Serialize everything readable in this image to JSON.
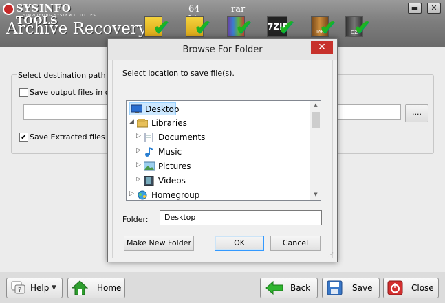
{
  "header": {
    "brand": "SYSINFO TOOLS",
    "brand_tagline": "SIMPLIFYING SYSTEM UTILITIES",
    "title": "Archive Recovery",
    "formats": [
      {
        "icon": "zip-archive-icon",
        "label": ""
      },
      {
        "icon": "zip-archive-64bit-icon",
        "label": "64 bit"
      },
      {
        "icon": "rar-archive-icon",
        "label": "rar"
      },
      {
        "icon": "7zip-archive-icon",
        "label": "7ZIP"
      },
      {
        "icon": "tar-archive-icon",
        "label": "TAR"
      },
      {
        "icon": "gz-archive-icon",
        "label": "GZ"
      }
    ],
    "check_color": "#1fb31f"
  },
  "window_controls": {
    "minimize": "▬",
    "close": "✕"
  },
  "main": {
    "group_title": "Select destination path to sa",
    "option_original": {
      "label": "Save output files in origi",
      "checked": false
    },
    "path_value": "",
    "browse_label": "....",
    "option_extracted": {
      "label": "Save Extracted files in s",
      "checked": true
    }
  },
  "footer": {
    "help_label": "Help",
    "home_label": "Home",
    "back_label": "Back",
    "save_label": "Save",
    "close_label": "Close"
  },
  "dialog": {
    "title": "Browse For Folder",
    "close_glyph": "✕",
    "instruction": "Select location to save file(s).",
    "tree": [
      {
        "label": "Desktop",
        "icon": "desktop-icon",
        "level": 0,
        "expander": "",
        "selected": true
      },
      {
        "label": "Libraries",
        "icon": "libraries-icon",
        "level": 0,
        "expander": "◢",
        "selected": false
      },
      {
        "label": "Documents",
        "icon": "documents-icon",
        "level": 1,
        "expander": "▷",
        "selected": false
      },
      {
        "label": "Music",
        "icon": "music-icon",
        "level": 1,
        "expander": "▷",
        "selected": false
      },
      {
        "label": "Pictures",
        "icon": "pictures-icon",
        "level": 1,
        "expander": "▷",
        "selected": false
      },
      {
        "label": "Videos",
        "icon": "videos-icon",
        "level": 1,
        "expander": "▷",
        "selected": false
      },
      {
        "label": "Homegroup",
        "icon": "homegroup-icon",
        "level": 0,
        "expander": "▷",
        "selected": false
      }
    ],
    "folder_label": "Folder:",
    "folder_value": "Desktop",
    "make_new_folder": "Make New Folder",
    "ok": "OK",
    "cancel": "Cancel"
  }
}
